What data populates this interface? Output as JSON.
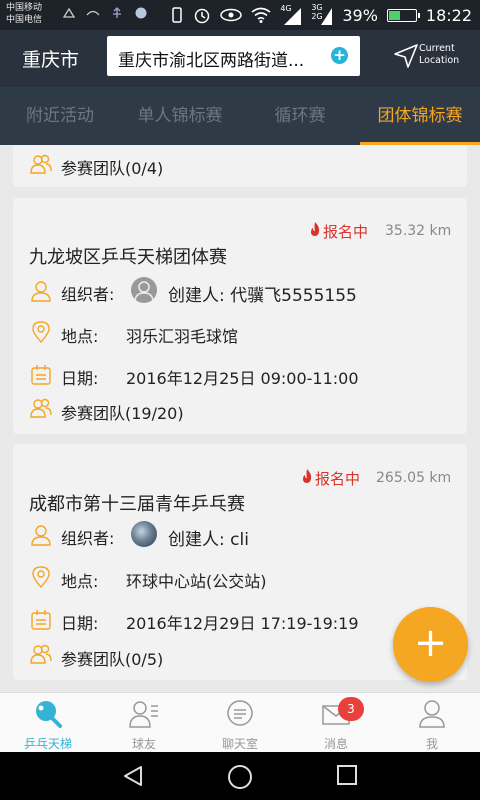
{
  "status_bar": {
    "carrier1": "中国移动",
    "carrier2": "中国电信",
    "network_4g": "4G",
    "network_3g": "3G",
    "network_2g": "2G",
    "battery_percent": "39%",
    "battery_level": 0.39,
    "time": "18:22"
  },
  "header": {
    "city": "重庆市",
    "address": "重庆市渝北区两路街道...",
    "current_location_line1": "Current",
    "current_location_line2": "Location"
  },
  "tabs": [
    {
      "label": "附近活动"
    },
    {
      "label": "单人锦标赛"
    },
    {
      "label": "循环赛"
    },
    {
      "label": "团体锦标赛"
    }
  ],
  "events": [
    {
      "team_label": "参赛团队(0/4)"
    },
    {
      "status": "报名中",
      "distance": "35.32 km",
      "title": "九龙坡区乒乓天梯团体赛",
      "organizer_label": "组织者:",
      "creator": "创建人: 代骥飞5555155",
      "location_label": "地点:",
      "location": "羽乐汇羽毛球馆",
      "date_label": "日期:",
      "date": "2016年12月25日 09:00-11:00",
      "team_label": "参赛团队(19/20)"
    },
    {
      "status": "报名中",
      "distance": "265.05 km",
      "title": "成都市第十三届青年乒乓赛",
      "organizer_label": "组织者:",
      "creator": "创建人: cli",
      "location_label": "地点:",
      "location": "环球中心站(公交站)",
      "date_label": "日期:",
      "date": "2016年12月29日 17:19-19:19",
      "team_label": "参赛团队(0/5)"
    }
  ],
  "fab": {
    "label": "+"
  },
  "bottom_nav": [
    {
      "label": "乒乓天梯",
      "icon": "paddle-icon"
    },
    {
      "label": "球友",
      "icon": "friends-icon"
    },
    {
      "label": "聊天室",
      "icon": "chat-icon"
    },
    {
      "label": "消息",
      "icon": "mail-icon"
    },
    {
      "label": "我",
      "icon": "user-icon"
    }
  ],
  "messages_badge": "3",
  "colors": {
    "accent": "#f5a623",
    "active_nav": "#35b3d5",
    "status_red": "#d9342b",
    "header_bg": "#2a323e"
  }
}
